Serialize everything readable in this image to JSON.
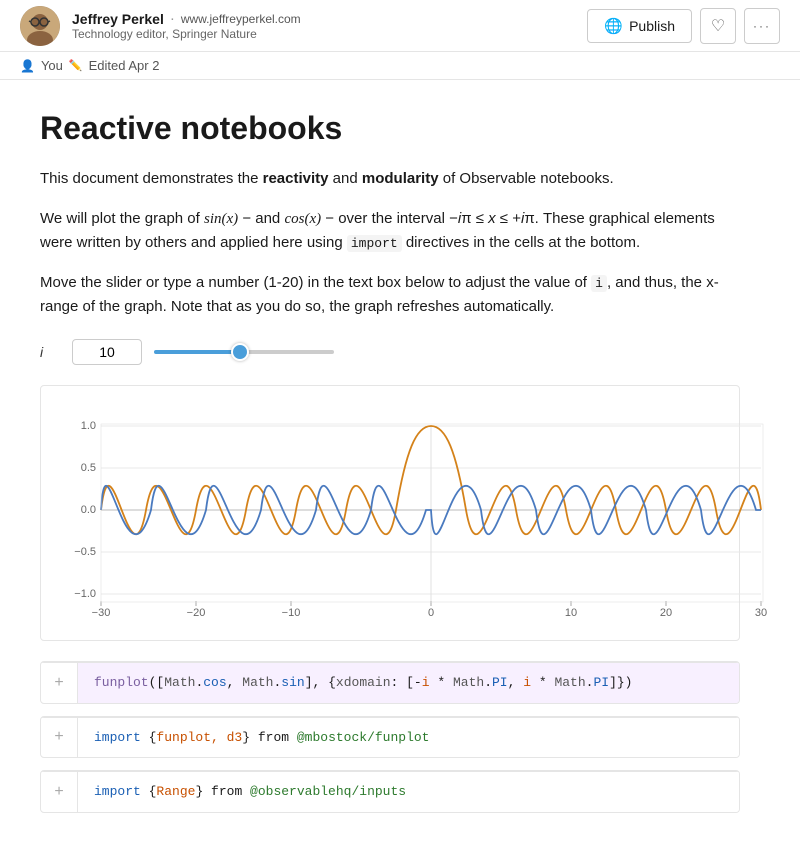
{
  "header": {
    "author_name": "Jeffrey Perkel",
    "author_separator": "·",
    "author_url": "www.jeffreyperkel.com",
    "author_role": "Technology editor, Springer Nature",
    "publish_label": "Publish",
    "you_label": "You",
    "edited_label": "Edited Apr 2"
  },
  "content": {
    "title": "Reactive notebooks",
    "para1_prefix": "This document demonstrates the ",
    "para1_bold1": "reactivity",
    "para1_middle": " and ",
    "para1_bold2": "modularity",
    "para1_suffix": " of Observable notebooks.",
    "para2": "We will plot the graph of sin(x) − and cos(x) − over the interval −iπ ≤ x ≤ +iπ. These graphical elements were written by others and applied here using ",
    "para2_code": "import",
    "para2_suffix": " directives in the cells at the bottom.",
    "para3_prefix": "Move the slider or type a number (1-20) in the text box below to adjust the value of ",
    "para3_code": "i",
    "para3_suffix": ", and thus, the x-range of the graph. Note that as you do so, the graph refreshes automatically.",
    "slider_label": "i",
    "slider_value": "10",
    "slider_min": 1,
    "slider_max": 20,
    "slider_current": 10
  },
  "chart": {
    "x_labels": [
      "-30",
      "-20",
      "-10",
      "0",
      "10",
      "20",
      "30"
    ],
    "y_labels": [
      "1.0",
      "0.5",
      "0.0",
      "-0.5",
      "-1.0"
    ],
    "sin_color": "#4a7abf",
    "cos_color": "#d4821a"
  },
  "cells": [
    {
      "id": "cell-funplot",
      "type": "code",
      "highlighted": true,
      "code": "funplot([Math.cos, Math.sin], {xdomain: [-i * Math.PI, i * Math.PI]})"
    },
    {
      "id": "cell-import1",
      "type": "import",
      "highlighted": false,
      "code_prefix": "import {",
      "code_imports": "funplot, d3",
      "code_middle": "} from ",
      "code_source": "@mbostock/funplot"
    },
    {
      "id": "cell-import2",
      "type": "import",
      "highlighted": false,
      "code_prefix": "import {",
      "code_imports": "Range",
      "code_middle": "} from ",
      "code_source": "@observablehq/inputs"
    }
  ]
}
